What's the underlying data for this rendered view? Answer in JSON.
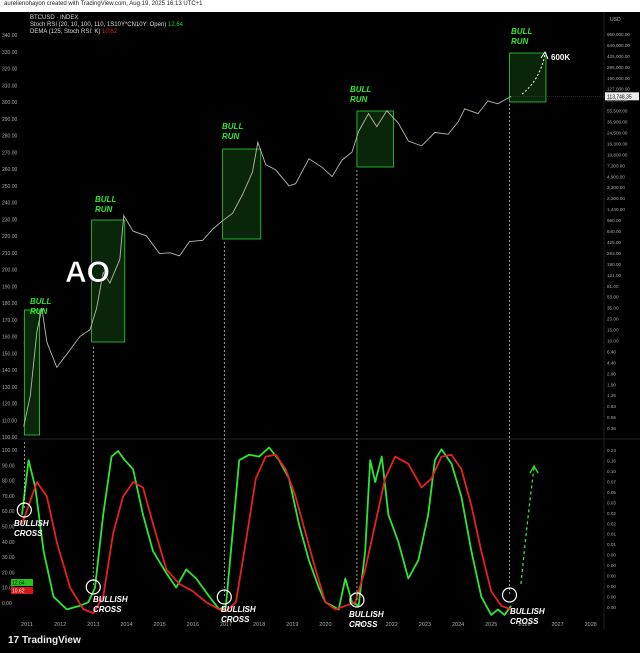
{
  "header": {
    "credit": "aurelienohayon created with TradingView.com, Aug 19, 2025 16:13 UTC+1"
  },
  "legend": {
    "symbol": "BTCUSD · INDEX",
    "indicator": "Stoch RSI (20, 10, 100, 110, 1S10Y*CN10Y: Open)",
    "indicator_value": "12.64",
    "dema": "DEMA (125, Stoch RSI: K)",
    "dema_value": "10.62"
  },
  "footer": {
    "brand": "TradingView",
    "logo": "17"
  },
  "price_panel": {
    "currency": "USD",
    "last_price": "113,748.35",
    "left_ticks": [
      "340.00",
      "330.00",
      "320.00",
      "310.00",
      "300.00",
      "290.00",
      "280.00",
      "270.00",
      "260.00",
      "250.00",
      "240.00",
      "230.00",
      "220.00",
      "210.00",
      "200.00",
      "190.00",
      "180.00",
      "170.00",
      "160.00",
      "150.00",
      "140.00",
      "130.00",
      "120.00",
      "110.00",
      "100.00"
    ],
    "right_ticks": [
      "960,000.00",
      "640,000.00",
      "425,000.00",
      "285,000.00",
      "190,000.00",
      "127,000.00",
      "85,000.00",
      "55,500.00",
      "36,900.00",
      "24,500.00",
      "16,300.00",
      "10,800.00",
      "7,200.00",
      "4,900.00",
      "3,300.00",
      "2,200.00",
      "1,440.00",
      "960.00",
      "640.00",
      "425.00",
      "283.00",
      "190.00",
      "121.00",
      "81.00",
      "53.00",
      "35.00",
      "23.00",
      "15.00",
      "10.00",
      "6.40",
      "4.40",
      "2.90",
      "1.90",
      "1.25",
      "0.83",
      "0.55",
      "0.36"
    ]
  },
  "osc_panel": {
    "left_ticks": [
      "100.00",
      "90.00",
      "80.00",
      "70.00",
      "60.00",
      "50.00",
      "40.00",
      "30.00",
      "20.00",
      "10.00",
      "0.00"
    ],
    "right_ticks": [
      "0.23",
      "0.16",
      "0.10",
      "0.07",
      "0.05",
      "0.03",
      "0.02",
      "0.02",
      "0.01",
      "0.01",
      "0.00",
      "0.00",
      "0.00",
      "0.00",
      "0.00",
      "0.00"
    ],
    "left_badges": [
      "12.64",
      "10.62"
    ]
  },
  "annotations": {
    "bull_run": [
      "BULL",
      "RUN"
    ],
    "bullish_cross": [
      "BULLISH",
      "CROSS"
    ],
    "ao": "AO",
    "target": "600K"
  },
  "chart_data": {
    "type": "line",
    "x_axis": [
      "2011",
      "2012",
      "2013",
      "2014",
      "2015",
      "2016",
      "2017",
      "2018",
      "2019",
      "2020",
      "2021",
      "2022",
      "2023",
      "2024",
      "2025",
      "2026",
      "2027",
      "2028"
    ],
    "price_scale": "log",
    "price_series": {
      "name": "BTCUSD",
      "x": [
        2010.9,
        2011.1,
        2011.3,
        2011.45,
        2011.6,
        2011.9,
        2012.2,
        2012.6,
        2012.9,
        2013.1,
        2013.3,
        2013.5,
        2013.8,
        2013.92,
        2014.2,
        2014.6,
        2015.0,
        2015.3,
        2015.6,
        2015.9,
        2016.3,
        2016.6,
        2016.9,
        2017.2,
        2017.5,
        2017.8,
        2017.96,
        2018.2,
        2018.5,
        2018.9,
        2019.1,
        2019.5,
        2019.9,
        2020.2,
        2020.5,
        2020.8,
        2021.0,
        2021.3,
        2021.55,
        2021.85,
        2022.2,
        2022.5,
        2022.9,
        2023.3,
        2023.7,
        2024.0,
        2024.2,
        2024.6,
        2024.9,
        2025.2,
        2025.6
      ],
      "y": [
        0.3,
        1,
        12,
        30,
        8,
        3,
        5,
        10,
        13,
        30,
        120,
        80,
        200,
        1100,
        600,
        500,
        250,
        260,
        230,
        400,
        420,
        650,
        900,
        1200,
        2500,
        6000,
        19000,
        8000,
        6500,
        3500,
        3800,
        10000,
        7200,
        5000,
        9500,
        13000,
        29000,
        58000,
        35000,
        65000,
        40000,
        20000,
        16500,
        28000,
        26000,
        42000,
        70000,
        58000,
        95000,
        85000,
        113748
      ]
    },
    "oscillator_series": [
      {
        "name": "Stoch RSI",
        "x": [
          2010.85,
          2011.05,
          2011.25,
          2011.5,
          2011.8,
          2012.2,
          2012.6,
          2012.85,
          2013.05,
          2013.3,
          2013.55,
          2013.75,
          2013.95,
          2014.2,
          2014.5,
          2014.8,
          2015.2,
          2015.5,
          2015.8,
          2016.1,
          2016.5,
          2016.8,
          2017.0,
          2017.2,
          2017.4,
          2017.7,
          2018.0,
          2018.3,
          2018.6,
          2018.9,
          2019.2,
          2019.5,
          2019.8,
          2020.0,
          2020.2,
          2020.4,
          2020.6,
          2020.8,
          2021.0,
          2021.2,
          2021.35,
          2021.5,
          2021.7,
          2021.9,
          2022.2,
          2022.5,
          2022.8,
          2023.1,
          2023.3,
          2023.5,
          2023.8,
          2024.1,
          2024.4,
          2024.7,
          2025.0,
          2025.2,
          2025.4,
          2025.6
        ],
        "y": [
          60,
          90,
          75,
          40,
          15,
          8,
          10,
          12,
          20,
          60,
          92,
          95,
          90,
          85,
          60,
          40,
          28,
          20,
          30,
          25,
          15,
          8,
          10,
          50,
          90,
          93,
          92,
          97,
          90,
          80,
          55,
          35,
          20,
          12,
          10,
          8,
          25,
          12,
          10,
          40,
          90,
          78,
          92,
          60,
          45,
          25,
          35,
          60,
          90,
          96,
          88,
          70,
          40,
          15,
          5,
          8,
          5,
          10
        ]
      },
      {
        "name": "DEMA",
        "x": [
          2010.85,
          2011.05,
          2011.3,
          2011.6,
          2011.9,
          2012.3,
          2012.7,
          2013.0,
          2013.3,
          2013.6,
          2013.9,
          2014.2,
          2014.5,
          2014.8,
          2015.2,
          2015.6,
          2016.0,
          2016.4,
          2016.8,
          2017.0,
          2017.3,
          2017.6,
          2017.9,
          2018.2,
          2018.5,
          2018.8,
          2019.1,
          2019.4,
          2019.7,
          2020.0,
          2020.3,
          2020.6,
          2020.9,
          2021.2,
          2021.5,
          2021.8,
          2022.1,
          2022.5,
          2022.9,
          2023.2,
          2023.5,
          2023.8,
          2024.1,
          2024.4,
          2024.7,
          2025.0,
          2025.3,
          2025.6
        ],
        "y": [
          55,
          65,
          78,
          70,
          45,
          20,
          8,
          6,
          15,
          50,
          70,
          78,
          75,
          55,
          30,
          22,
          18,
          12,
          8,
          7,
          12,
          45,
          80,
          92,
          93,
          85,
          70,
          50,
          30,
          12,
          8,
          10,
          12,
          30,
          55,
          80,
          92,
          88,
          75,
          80,
          92,
          93,
          85,
          65,
          40,
          18,
          10,
          8
        ]
      }
    ],
    "osc_ylim": [
      0,
      100
    ]
  }
}
